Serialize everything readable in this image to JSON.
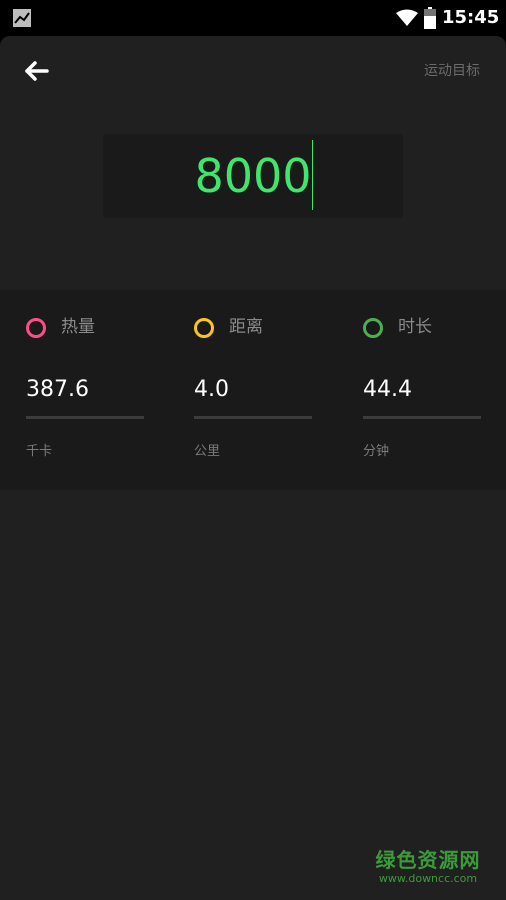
{
  "status_bar": {
    "time": "15:45",
    "left_icon": "image-icon",
    "wifi_icon": "wifi-icon",
    "battery_icon": "battery-icon"
  },
  "header": {
    "back_icon": "arrow-left-icon",
    "title": "运动目标"
  },
  "goal": {
    "value": "8000"
  },
  "stats": [
    {
      "label": "热量",
      "value": "387.6",
      "unit": "千卡",
      "color": "#ff4d88"
    },
    {
      "label": "距离",
      "value": "4.0",
      "unit": "公里",
      "color": "#ffc61a"
    },
    {
      "label": "时长",
      "value": "44.4",
      "unit": "分钟",
      "color": "#4caf50"
    }
  ],
  "watermark": {
    "name": "绿色资源网",
    "url": "www.downcc.com"
  },
  "colors": {
    "accent_green": "#3ee66b",
    "background": "#202020",
    "panel": "#1a1a1a"
  }
}
